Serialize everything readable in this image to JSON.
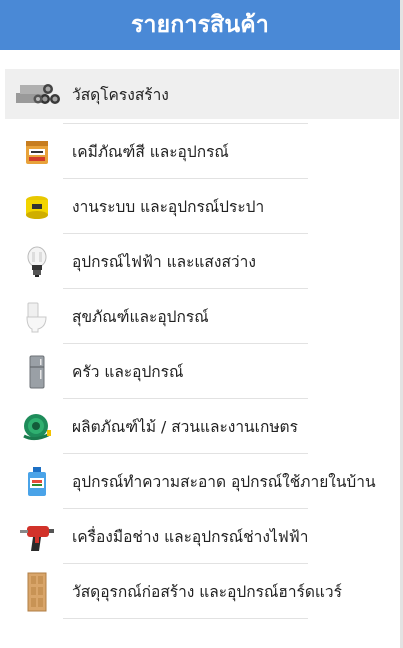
{
  "header": {
    "title": "รายการสินค้า"
  },
  "menu": {
    "items": [
      {
        "label": "วัสดุโครงสร้าง",
        "icon": "steel-pipes-icon"
      },
      {
        "label": "เคมีภัณฑ์สี และอุปกรณ์",
        "icon": "paint-bucket-icon"
      },
      {
        "label": "งานระบบ และอุปกรณ์ประปา",
        "icon": "water-pump-icon"
      },
      {
        "label": "อุปกรณ์ไฟฟ้า และแสงสว่าง",
        "icon": "light-bulb-icon"
      },
      {
        "label": "สุขภัณฑ์และอุปกรณ์",
        "icon": "toilet-icon"
      },
      {
        "label": "ครัว และอุปกรณ์",
        "icon": "refrigerator-icon"
      },
      {
        "label": "ผลิตภัณฑ์ไม้ / สวนและงานเกษตร",
        "icon": "garden-hose-reel-icon"
      },
      {
        "label": "อุปกรณ์ทำความสะอาด อุปกรณ์ใช้ภายในบ้าน",
        "icon": "cleaning-bottle-icon"
      },
      {
        "label": "เครื่องมือช่าง และอุปกรณ์ช่างไฟฟ้า",
        "icon": "power-drill-icon"
      },
      {
        "label": "วัสดุอุรกณ์ก่อสร้าง และอุปกรณ์ฮาร์ดแวร์",
        "icon": "wooden-door-icon"
      }
    ]
  },
  "colors": {
    "header_bg": "#4a89d6",
    "active_row_bg": "#efefef"
  }
}
